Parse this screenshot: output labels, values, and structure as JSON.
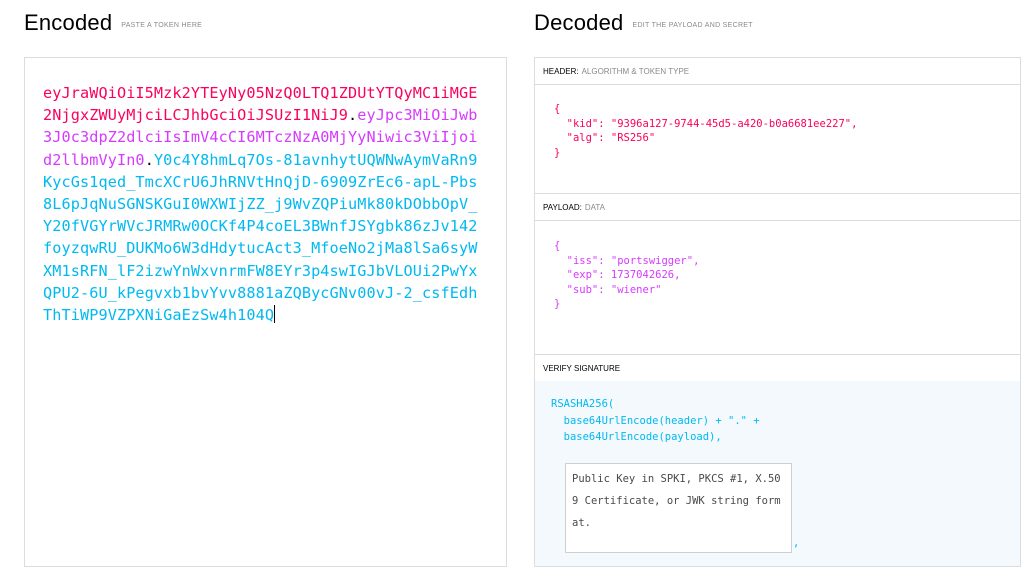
{
  "encoded": {
    "title": "Encoded",
    "subtitle": "PASTE A TOKEN HERE",
    "token_header": "eyJraWQiOiI5Mzk2YTEyNy05NzQ0LTQ1ZDUtYTQyMC1iMGE2NjgxZWUyMjciLCJhbGciOiJSUzI1NiJ9",
    "token_payload": "eyJpc3MiOiJwb3J0c3dpZ2dlciIsImV4cCI6MTczNzA0MjYyNiwic3ViIjoid2llbmVyIn0",
    "token_signature": "Y0c4Y8hmLq7Os-81avnhytUQWNwAymVaRn9KycGs1qed_TmcXCrU6JhRNVtHnQjD-6909ZrEc6-apL-Pbs8L6pJqNuSGNSKGuI0WXWIjZZ_j9WvZQPiuMk80kDObbOpV_Y20fVGYrWVcJRMRw0OCKf4P4coEL3BWnfJSYgbk86zJv142foyzqwRU_DUKMo6W3dHdytucAct3_MfoeNo2jMa8lSa6syWXM1sRFN_lF2izwYnWxvnrmFW8EYr3p4swIGJbVLOUi2PwYxQPU2-6U_kPegvxb1bvYvv8881aZQBycGNv00vJ-2_csfEdhThTiWP9VZPXNiGaEzSw4h104Q",
    "dot": "."
  },
  "decoded": {
    "title": "Decoded",
    "subtitle": "EDIT THE PAYLOAD AND SECRET",
    "header_section": {
      "label": "HEADER:",
      "sub": "ALGORITHM & TOKEN TYPE",
      "json": "{\n  \"kid\": \"9396a127-9744-45d5-a420-b0a6681ee227\",\n  \"alg\": \"RS256\"\n}"
    },
    "payload_section": {
      "label": "PAYLOAD:",
      "sub": "DATA",
      "json": "{\n  \"iss\": \"portswigger\",\n  \"exp\": 1737042626,\n  \"sub\": \"wiener\"\n}"
    },
    "verify_section": {
      "label": "VERIFY SIGNATURE",
      "code": "RSASHA256(\n  base64UrlEncode(header) + \".\" +\n  base64UrlEncode(payload),",
      "key_placeholder": "Public Key in SPKI, PKCS #1, X.509 Certificate, or JWK string format.",
      "trailing": ","
    }
  },
  "colors": {
    "header": "#fb015b",
    "payload": "#d63aff",
    "signature": "#00b9f1"
  }
}
